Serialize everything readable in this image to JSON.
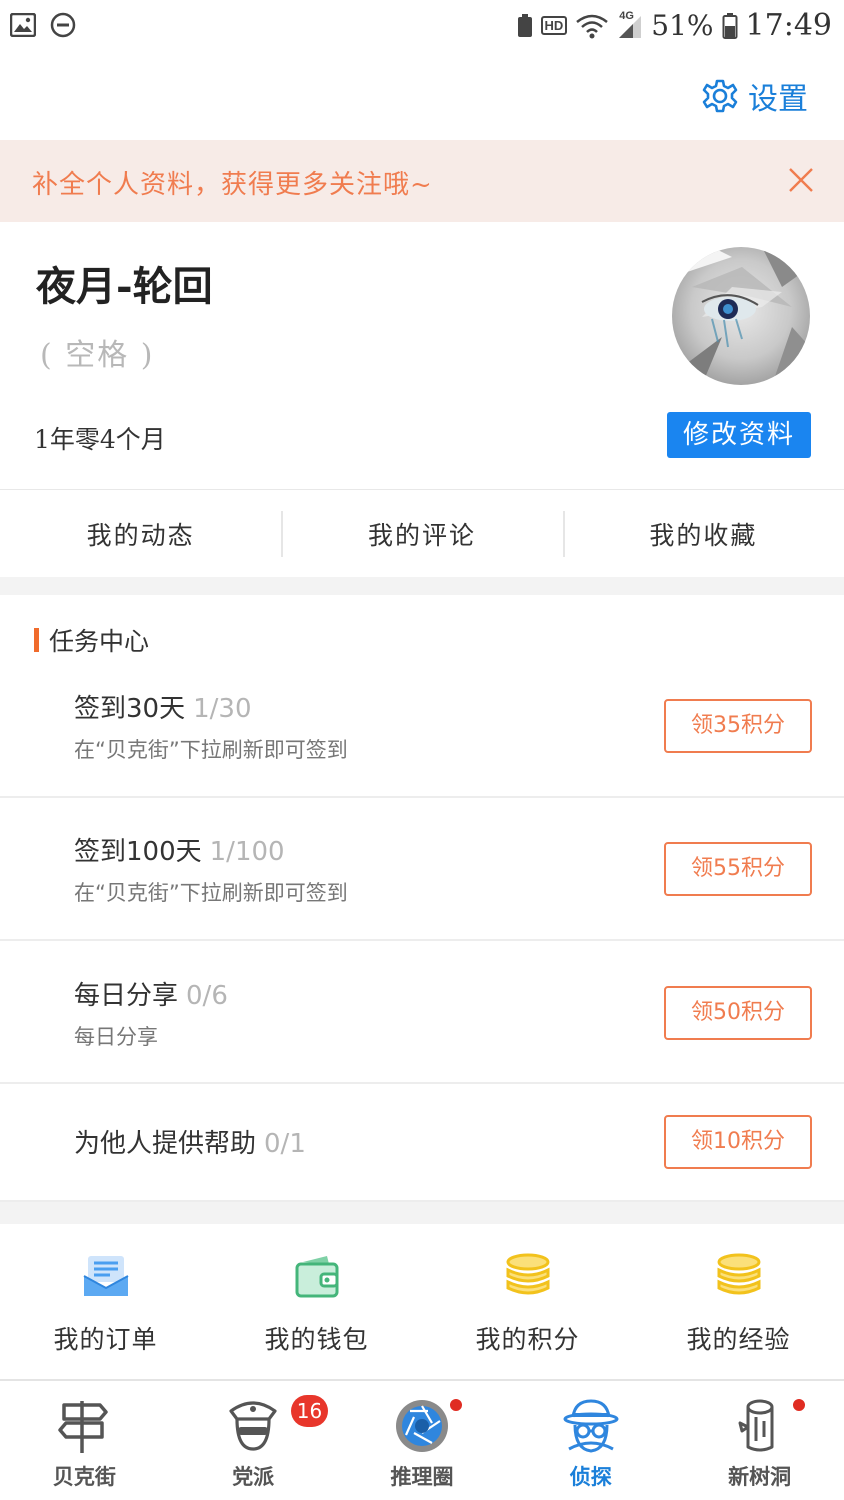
{
  "status_bar": {
    "network": "HD",
    "signal": "4G",
    "battery": "51%",
    "time": "17:49"
  },
  "header": {
    "settings_label": "设置"
  },
  "notice": {
    "text": "补全个人资料，获得更多关注哦~"
  },
  "profile": {
    "name": "夜月-轮回",
    "signature": "( 空格 )",
    "member_age": "1年零4个月",
    "edit_label": "修改资料"
  },
  "my_tabs": [
    "我的动态",
    "我的评论",
    "我的收藏"
  ],
  "task_center": {
    "title": "任务中心",
    "tasks": [
      {
        "name": "签到30天",
        "progress": "1/30",
        "desc": "在“贝克街”下拉刷新即可签到",
        "button": "领35积分"
      },
      {
        "name": "签到100天",
        "progress": "1/100",
        "desc": "在“贝克街”下拉刷新即可签到",
        "button": "领55积分"
      },
      {
        "name": "每日分享",
        "progress": "0/6",
        "desc": "每日分享",
        "button": "领50积分"
      },
      {
        "name": "为他人提供帮助",
        "progress": "0/1",
        "desc": "",
        "button": "领10积分"
      }
    ]
  },
  "quick_links": [
    {
      "label": "我的订单",
      "icon": "order-icon"
    },
    {
      "label": "我的钱包",
      "icon": "wallet-icon"
    },
    {
      "label": "我的积分",
      "icon": "coins-icon"
    },
    {
      "label": "我的经验",
      "icon": "coins-icon"
    }
  ],
  "bottom_nav": [
    {
      "label": "贝克街",
      "icon": "signpost-icon"
    },
    {
      "label": "党派",
      "icon": "police-cap-icon",
      "badge": "16"
    },
    {
      "label": "推理圈",
      "icon": "camera-aperture-icon"
    },
    {
      "label": "侦探",
      "icon": "detective-icon",
      "active": true
    },
    {
      "label": "新树洞",
      "icon": "tree-stump-icon"
    }
  ],
  "colors": {
    "accent_blue": "#1a85f0",
    "accent_orange": "#f07c4f",
    "notice_bg": "#f7ebe7",
    "badge_red": "#e8362b"
  }
}
